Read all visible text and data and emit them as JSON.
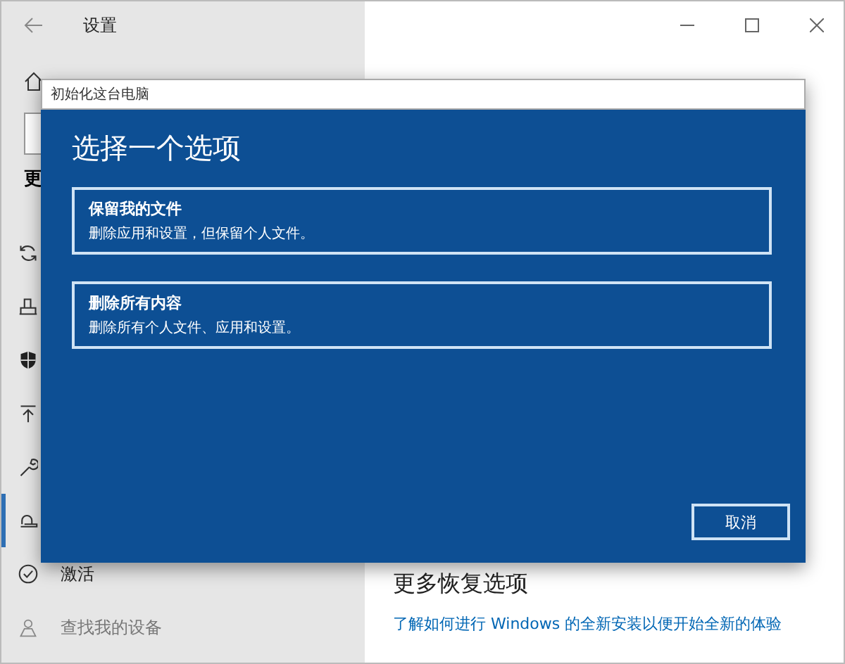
{
  "window": {
    "title": "设置"
  },
  "sidebar": {
    "heading": "更",
    "items": [
      {
        "selected": false
      },
      {
        "selected": false
      },
      {
        "selected": false
      },
      {
        "selected": false
      },
      {
        "selected": false
      },
      {
        "selected": true
      },
      {
        "label": "激活",
        "selected": false
      },
      {
        "label": "查找我的设备",
        "selected": false
      }
    ]
  },
  "content": {
    "heading": "更多恢复选项",
    "link": "了解如何进行 Windows 的全新安装以便开始全新的体验"
  },
  "dialog": {
    "title": "初始化这台电脑",
    "heading": "选择一个选项",
    "options": [
      {
        "title": "保留我的文件",
        "description": "删除应用和设置，但保留个人文件。"
      },
      {
        "title": "删除所有内容",
        "description": "删除所有个人文件、应用和设置。"
      }
    ],
    "cancel": "取消"
  }
}
